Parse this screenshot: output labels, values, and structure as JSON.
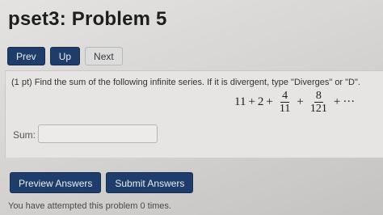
{
  "page": {
    "title": "pset3: Problem 5"
  },
  "nav": {
    "prev_label": "Prev",
    "up_label": "Up",
    "next_label": "Next"
  },
  "problem": {
    "text": "(1 pt) Find the sum of the following infinite series. If it is divergent, type \"Diverges\" or \"D\".",
    "series": {
      "t1": "11",
      "plus1": "+",
      "t2": "2",
      "plus2": "+",
      "f1_num": "4",
      "f1_den": "11",
      "plus3": "+",
      "f2_num": "8",
      "f2_den": "121",
      "plus4": "+",
      "ellipsis": "···"
    }
  },
  "answer": {
    "label": "Sum:",
    "value": "",
    "placeholder": ""
  },
  "actions": {
    "preview_label": "Preview Answers",
    "submit_label": "Submit Answers"
  },
  "status": {
    "attempts_text": "You have attempted this problem 0 times."
  }
}
